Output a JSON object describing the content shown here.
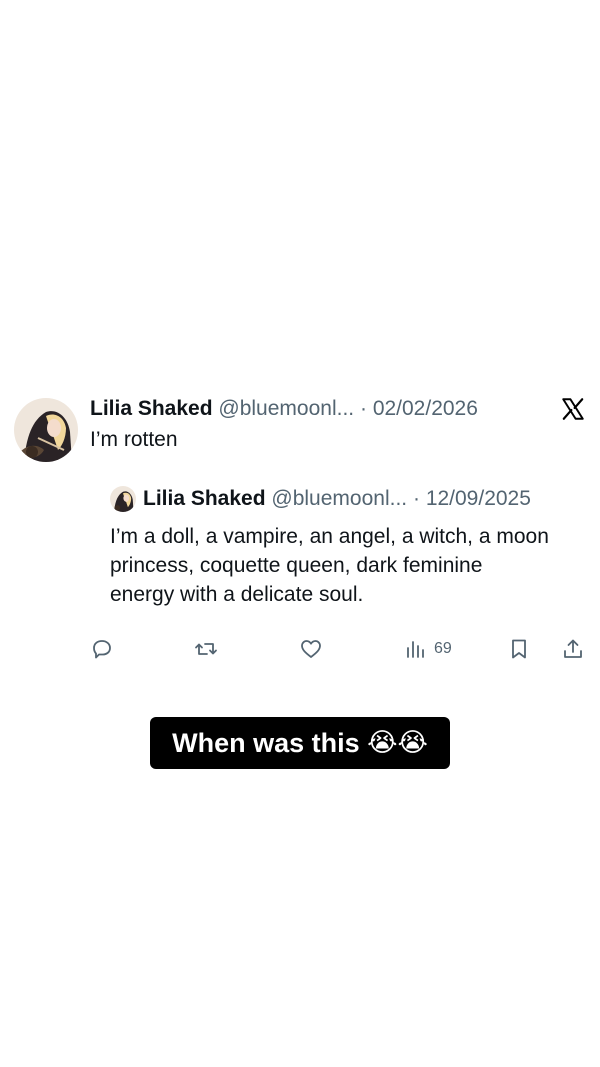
{
  "tweet": {
    "author_name": "Lilia Shaked",
    "handle": "@bluemoonl...",
    "separator": "·",
    "date": "02/02/2026",
    "text": "I’m rotten",
    "platform_icon": "x-logo-icon"
  },
  "quoted_tweet": {
    "author_name": "Lilia Shaked",
    "handle": "@bluemoonl...",
    "separator": "·",
    "date": "12/09/2025",
    "text": "I’m a doll, a vampire, an angel, a witch, a moon princess, coquette queen, dark feminine energy with a delicate soul."
  },
  "actions": {
    "reply_icon": "reply-icon",
    "retweet_icon": "retweet-icon",
    "like_icon": "heart-icon",
    "views_icon": "views-chart-icon",
    "views_count": "69",
    "bookmark_icon": "bookmark-icon",
    "share_icon": "share-icon"
  },
  "caption": {
    "text": "When was this",
    "emoji": "😭😭"
  },
  "colors": {
    "text_primary": "#0f1419",
    "text_secondary": "#536471",
    "caption_bg": "#000000",
    "caption_text": "#ffffff"
  }
}
